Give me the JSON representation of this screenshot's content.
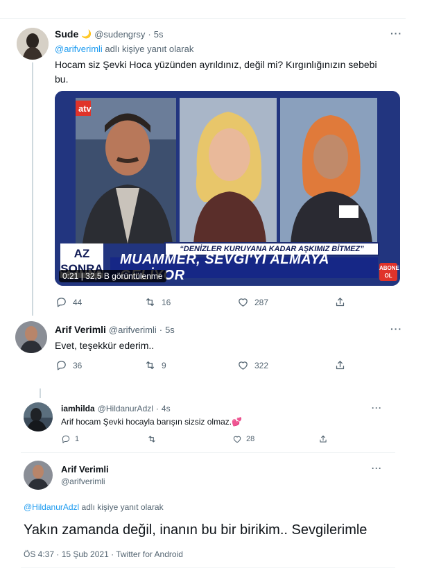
{
  "tweet1": {
    "name": "Sude",
    "emoji": "🌙",
    "handle": "@sudengrsy",
    "sep": "·",
    "time": "5s",
    "more": "···",
    "reply_to_handle": "@arifverimli",
    "reply_to_suffix": " adlı kişiye yanıt olarak",
    "text_line1": "Hocam siz Şevki Hoca yüzünden ayrıldınız, değil mi? Kırgınlığınızın sebebi",
    "text_line2": "bu.",
    "media": {
      "banner_top": "“DENİZLER KURUYANA KADAR AŞKIMIZ BİTMEZ”",
      "banner_main": "MUAMMER, SEVGİ'Yİ ALMAYA GELİYOR",
      "az_badge_line1": "AZ",
      "az_badge_line2": "SONRA",
      "video_meta": "0:21 | 32,5 B görüntülenme",
      "abone_line1": "ABONE",
      "abone_line2": "OL",
      "channel_logo": "atv"
    },
    "replies": "44",
    "retweets": "16",
    "likes": "287"
  },
  "tweet2": {
    "name": "Arif Verimli",
    "handle": "@arifverimli",
    "sep": "·",
    "time": "5s",
    "more": "···",
    "text": "Evet, teşekkür ederim..",
    "replies": "36",
    "retweets": "9",
    "likes": "322"
  },
  "tweet3": {
    "name": "iamhilda",
    "handle": "@HildanurAdzl",
    "sep": "·",
    "time": "4s",
    "more": "···",
    "text": "Arif hocam Şevki hocayla barışın sizsiz olmaz.",
    "emoji": "💕",
    "replies": "1",
    "retweets": "",
    "likes": "28"
  },
  "tweet4": {
    "name": "Arif Verimli",
    "handle": "@arifverimli",
    "more": "···",
    "reply_to_handle": "@HildanurAdzl",
    "reply_to_suffix": " adlı kişiye yanıt olarak",
    "text": "Yakın zamanda değil, inanın bu bir birikim.. Sevgilerimle",
    "meta": "ÖS 4:37 · 15 Şub 2021 · Twitter for Android"
  },
  "icons": [
    "reply-icon",
    "retweet-icon",
    "like-icon",
    "share-icon",
    "more-icon"
  ],
  "colors": {
    "link": "#1d9bf0",
    "muted": "#536471",
    "banner_blue": "#162786",
    "abone_red": "#e0332a"
  }
}
